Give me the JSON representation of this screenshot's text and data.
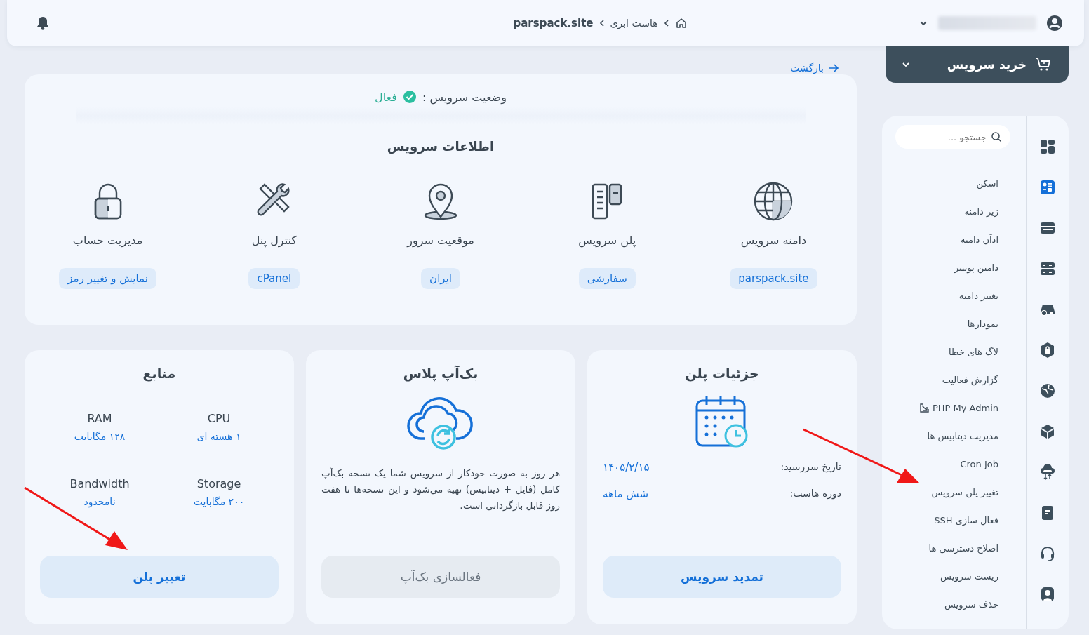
{
  "top_bar": {
    "breadcrumb": [
      {
        "label": "هاست ابری",
        "current": false
      },
      {
        "label": "parspack.site",
        "current": true
      }
    ]
  },
  "buy_button": {
    "label": "خرید سرویس"
  },
  "back_link": "بازگشت",
  "service_status": {
    "label": "وضعیت سرویس :",
    "value": "فعال",
    "active": true
  },
  "service_info": {
    "title": "اطلاعات سرویس",
    "items": [
      {
        "kind": "globe",
        "label": "دامنه سرویس",
        "value": "parspack.site"
      },
      {
        "kind": "plan",
        "label": "پلن سرویس",
        "value": "سفارشی"
      },
      {
        "kind": "location",
        "label": "موقعیت سرور",
        "value": "ایران"
      },
      {
        "kind": "tools",
        "label": "کنترل پنل",
        "value": "cPanel"
      },
      {
        "kind": "lock",
        "label": "مدیریت حساب",
        "value": "نمایش و تغییر رمز"
      }
    ]
  },
  "plan_details": {
    "title": "جزئیات پلن",
    "rows": [
      {
        "label": "تاریخ سررسید:",
        "value": "۱۴۰۵/۲/۱۵"
      },
      {
        "label": "دوره هاست:",
        "value": "شش ماهه"
      }
    ],
    "button": "تمدید سرویس"
  },
  "backup_plus": {
    "title": "بک‌آپ پلاس",
    "description": "هر روز به صورت خودکار از سرویس شما یک نسخه بک‌آپ کامل (فایل + دیتابیس) تهیه می‌شود و این نسخه‌ها تا هفت روز قابل بازگردانی است.",
    "button": {
      "label": "فعالسازی بک‌آپ",
      "disabled": true
    }
  },
  "resources": {
    "title": "منابع",
    "items": [
      {
        "label": "CPU",
        "value": "۱ هسته ای"
      },
      {
        "label": "RAM",
        "value": "۱۲۸ مگابایت"
      },
      {
        "label": "Storage",
        "value": "۲۰۰ مگابایت"
      },
      {
        "label": "Bandwidth",
        "value": "نامحدود"
      }
    ],
    "button": "تغییر پلن"
  },
  "sidebar": {
    "search": {
      "placeholder": "جستجو ..."
    },
    "menu": [
      {
        "label": "اسکن",
        "external": false
      },
      {
        "label": "زیر دامنه",
        "external": false
      },
      {
        "label": "ادآن دامنه",
        "external": false
      },
      {
        "label": "دامین پوینتر",
        "external": false
      },
      {
        "label": "تغییر دامنه",
        "external": false
      },
      {
        "label": "نمودارها",
        "external": false
      },
      {
        "label": "لاگ های خطا",
        "external": false
      },
      {
        "label": "گزارش فعالیت",
        "external": false
      },
      {
        "label": "PHP My Admin",
        "external": true
      },
      {
        "label": "مدیریت دیتابیس ها",
        "external": false
      },
      {
        "label": "Cron Job",
        "external": false
      },
      {
        "label": "تغییر پلن سرویس",
        "external": false
      },
      {
        "label": "فعال سازی SSH",
        "external": false
      },
      {
        "label": "اصلاح دسترسی ها",
        "external": false
      },
      {
        "label": "ریست سرویس",
        "external": false
      },
      {
        "label": "حذف سرویس",
        "external": false
      }
    ],
    "rail": [
      {
        "kind": "dashboard",
        "selected": false
      },
      {
        "kind": "hosting",
        "selected": true
      },
      {
        "kind": "www",
        "selected": false
      },
      {
        "kind": "server",
        "selected": false
      },
      {
        "kind": "cloud-drive",
        "selected": false
      },
      {
        "kind": "shield",
        "selected": false
      },
      {
        "kind": "network",
        "selected": false
      },
      {
        "kind": "cube",
        "selected": false
      },
      {
        "kind": "cloud-transfer",
        "selected": false
      },
      {
        "kind": "note",
        "selected": false
      },
      {
        "kind": "headset",
        "selected": false
      },
      {
        "kind": "user",
        "selected": false
      }
    ]
  }
}
